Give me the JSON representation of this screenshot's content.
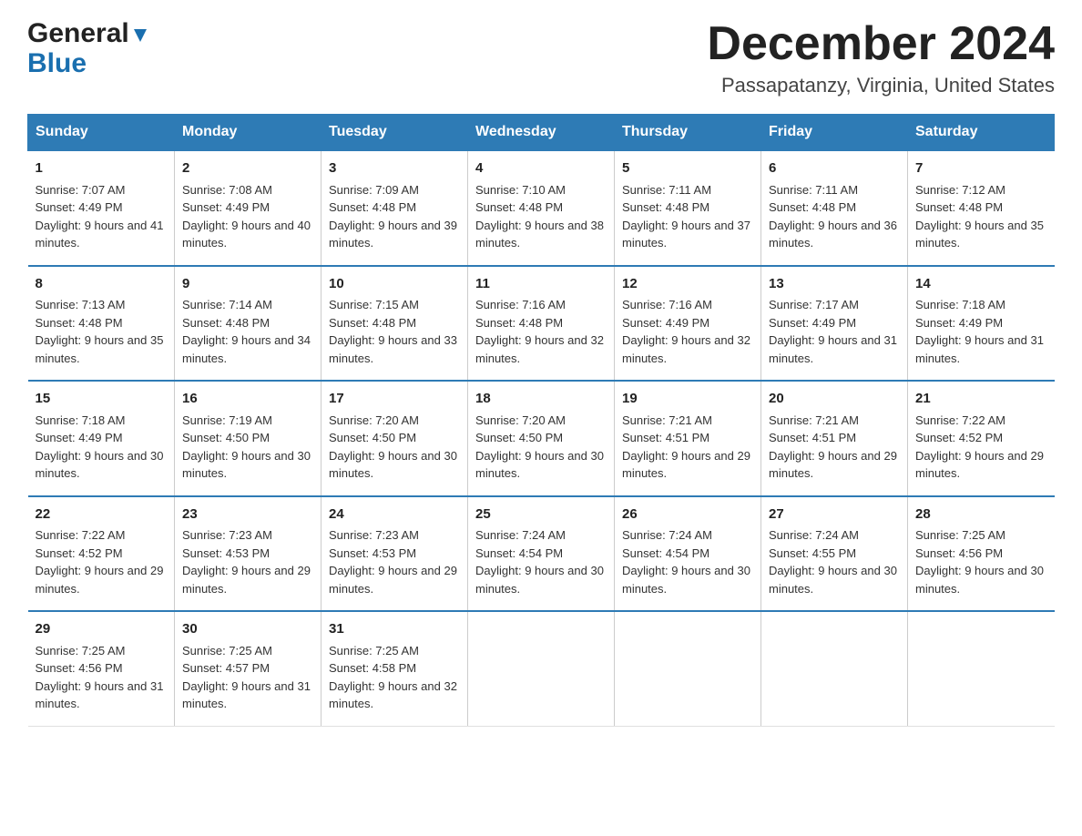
{
  "header": {
    "logo_line1": "General",
    "logo_line2": "Blue",
    "month_title": "December 2024",
    "location": "Passapatanzy, Virginia, United States"
  },
  "calendar": {
    "days_of_week": [
      "Sunday",
      "Monday",
      "Tuesday",
      "Wednesday",
      "Thursday",
      "Friday",
      "Saturday"
    ],
    "weeks": [
      [
        {
          "day": "1",
          "sunrise": "7:07 AM",
          "sunset": "4:49 PM",
          "daylight": "9 hours and 41 minutes."
        },
        {
          "day": "2",
          "sunrise": "7:08 AM",
          "sunset": "4:49 PM",
          "daylight": "9 hours and 40 minutes."
        },
        {
          "day": "3",
          "sunrise": "7:09 AM",
          "sunset": "4:48 PM",
          "daylight": "9 hours and 39 minutes."
        },
        {
          "day": "4",
          "sunrise": "7:10 AM",
          "sunset": "4:48 PM",
          "daylight": "9 hours and 38 minutes."
        },
        {
          "day": "5",
          "sunrise": "7:11 AM",
          "sunset": "4:48 PM",
          "daylight": "9 hours and 37 minutes."
        },
        {
          "day": "6",
          "sunrise": "7:11 AM",
          "sunset": "4:48 PM",
          "daylight": "9 hours and 36 minutes."
        },
        {
          "day": "7",
          "sunrise": "7:12 AM",
          "sunset": "4:48 PM",
          "daylight": "9 hours and 35 minutes."
        }
      ],
      [
        {
          "day": "8",
          "sunrise": "7:13 AM",
          "sunset": "4:48 PM",
          "daylight": "9 hours and 35 minutes."
        },
        {
          "day": "9",
          "sunrise": "7:14 AM",
          "sunset": "4:48 PM",
          "daylight": "9 hours and 34 minutes."
        },
        {
          "day": "10",
          "sunrise": "7:15 AM",
          "sunset": "4:48 PM",
          "daylight": "9 hours and 33 minutes."
        },
        {
          "day": "11",
          "sunrise": "7:16 AM",
          "sunset": "4:48 PM",
          "daylight": "9 hours and 32 minutes."
        },
        {
          "day": "12",
          "sunrise": "7:16 AM",
          "sunset": "4:49 PM",
          "daylight": "9 hours and 32 minutes."
        },
        {
          "day": "13",
          "sunrise": "7:17 AM",
          "sunset": "4:49 PM",
          "daylight": "9 hours and 31 minutes."
        },
        {
          "day": "14",
          "sunrise": "7:18 AM",
          "sunset": "4:49 PM",
          "daylight": "9 hours and 31 minutes."
        }
      ],
      [
        {
          "day": "15",
          "sunrise": "7:18 AM",
          "sunset": "4:49 PM",
          "daylight": "9 hours and 30 minutes."
        },
        {
          "day": "16",
          "sunrise": "7:19 AM",
          "sunset": "4:50 PM",
          "daylight": "9 hours and 30 minutes."
        },
        {
          "day": "17",
          "sunrise": "7:20 AM",
          "sunset": "4:50 PM",
          "daylight": "9 hours and 30 minutes."
        },
        {
          "day": "18",
          "sunrise": "7:20 AM",
          "sunset": "4:50 PM",
          "daylight": "9 hours and 30 minutes."
        },
        {
          "day": "19",
          "sunrise": "7:21 AM",
          "sunset": "4:51 PM",
          "daylight": "9 hours and 29 minutes."
        },
        {
          "day": "20",
          "sunrise": "7:21 AM",
          "sunset": "4:51 PM",
          "daylight": "9 hours and 29 minutes."
        },
        {
          "day": "21",
          "sunrise": "7:22 AM",
          "sunset": "4:52 PM",
          "daylight": "9 hours and 29 minutes."
        }
      ],
      [
        {
          "day": "22",
          "sunrise": "7:22 AM",
          "sunset": "4:52 PM",
          "daylight": "9 hours and 29 minutes."
        },
        {
          "day": "23",
          "sunrise": "7:23 AM",
          "sunset": "4:53 PM",
          "daylight": "9 hours and 29 minutes."
        },
        {
          "day": "24",
          "sunrise": "7:23 AM",
          "sunset": "4:53 PM",
          "daylight": "9 hours and 29 minutes."
        },
        {
          "day": "25",
          "sunrise": "7:24 AM",
          "sunset": "4:54 PM",
          "daylight": "9 hours and 30 minutes."
        },
        {
          "day": "26",
          "sunrise": "7:24 AM",
          "sunset": "4:54 PM",
          "daylight": "9 hours and 30 minutes."
        },
        {
          "day": "27",
          "sunrise": "7:24 AM",
          "sunset": "4:55 PM",
          "daylight": "9 hours and 30 minutes."
        },
        {
          "day": "28",
          "sunrise": "7:25 AM",
          "sunset": "4:56 PM",
          "daylight": "9 hours and 30 minutes."
        }
      ],
      [
        {
          "day": "29",
          "sunrise": "7:25 AM",
          "sunset": "4:56 PM",
          "daylight": "9 hours and 31 minutes."
        },
        {
          "day": "30",
          "sunrise": "7:25 AM",
          "sunset": "4:57 PM",
          "daylight": "9 hours and 31 minutes."
        },
        {
          "day": "31",
          "sunrise": "7:25 AM",
          "sunset": "4:58 PM",
          "daylight": "9 hours and 32 minutes."
        },
        null,
        null,
        null,
        null
      ]
    ]
  },
  "labels": {
    "sunrise_prefix": "Sunrise: ",
    "sunset_prefix": "Sunset: ",
    "daylight_prefix": "Daylight: "
  }
}
